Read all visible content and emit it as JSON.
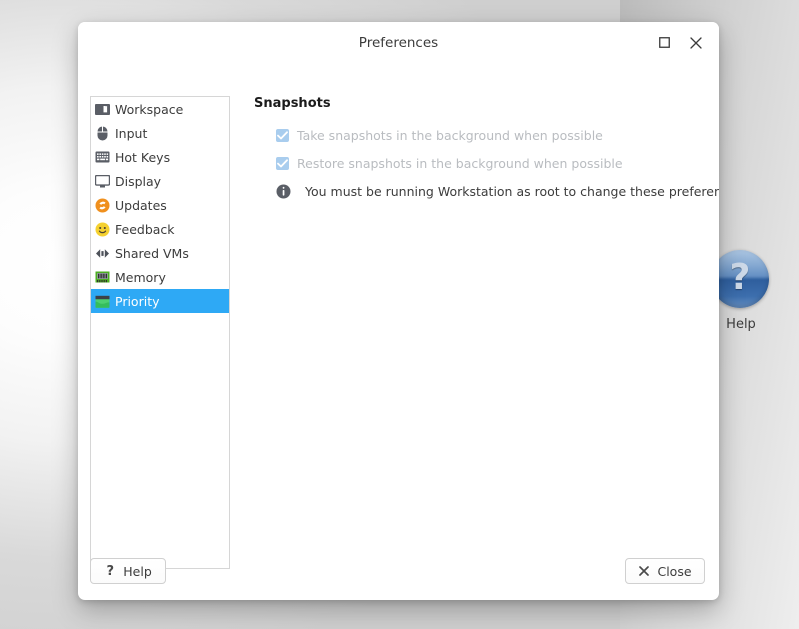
{
  "window": {
    "title": "Preferences",
    "controls": {
      "maximize": "maximize-button",
      "close": "close-button"
    }
  },
  "sidebar": {
    "items": [
      {
        "label": "Workspace",
        "icon": "workspace-icon",
        "selected": false
      },
      {
        "label": "Input",
        "icon": "mouse-icon",
        "selected": false
      },
      {
        "label": "Hot Keys",
        "icon": "keyboard-icon",
        "selected": false
      },
      {
        "label": "Display",
        "icon": "monitor-icon",
        "selected": false
      },
      {
        "label": "Updates",
        "icon": "refresh-icon",
        "selected": false
      },
      {
        "label": "Feedback",
        "icon": "smiley-icon",
        "selected": false
      },
      {
        "label": "Shared VMs",
        "icon": "share-arrows-icon",
        "selected": false
      },
      {
        "label": "Memory",
        "icon": "memory-chip-icon",
        "selected": false
      },
      {
        "label": "Priority",
        "icon": "priority-folder-icon",
        "selected": true
      }
    ]
  },
  "pane": {
    "heading": "Snapshots",
    "checkboxes": [
      {
        "label": "Take snapshots in the background when possible",
        "checked": true,
        "enabled": false
      },
      {
        "label": "Restore snapshots in the background when possible",
        "checked": true,
        "enabled": false
      }
    ],
    "info_message": "You must be running Workstation as root to change these preferences."
  },
  "footer": {
    "help_label": "Help",
    "close_label": "Close"
  },
  "desktop": {
    "help_orb_label": "Help",
    "help_orb_glyph": "?"
  },
  "colors": {
    "selection_blue": "#2ea9f5",
    "checkbox_disabled": "#a9cdee",
    "disabled_text": "#b9bcc0",
    "body_text": "#3c3c3c",
    "orb_blue": "#3d6fae"
  }
}
